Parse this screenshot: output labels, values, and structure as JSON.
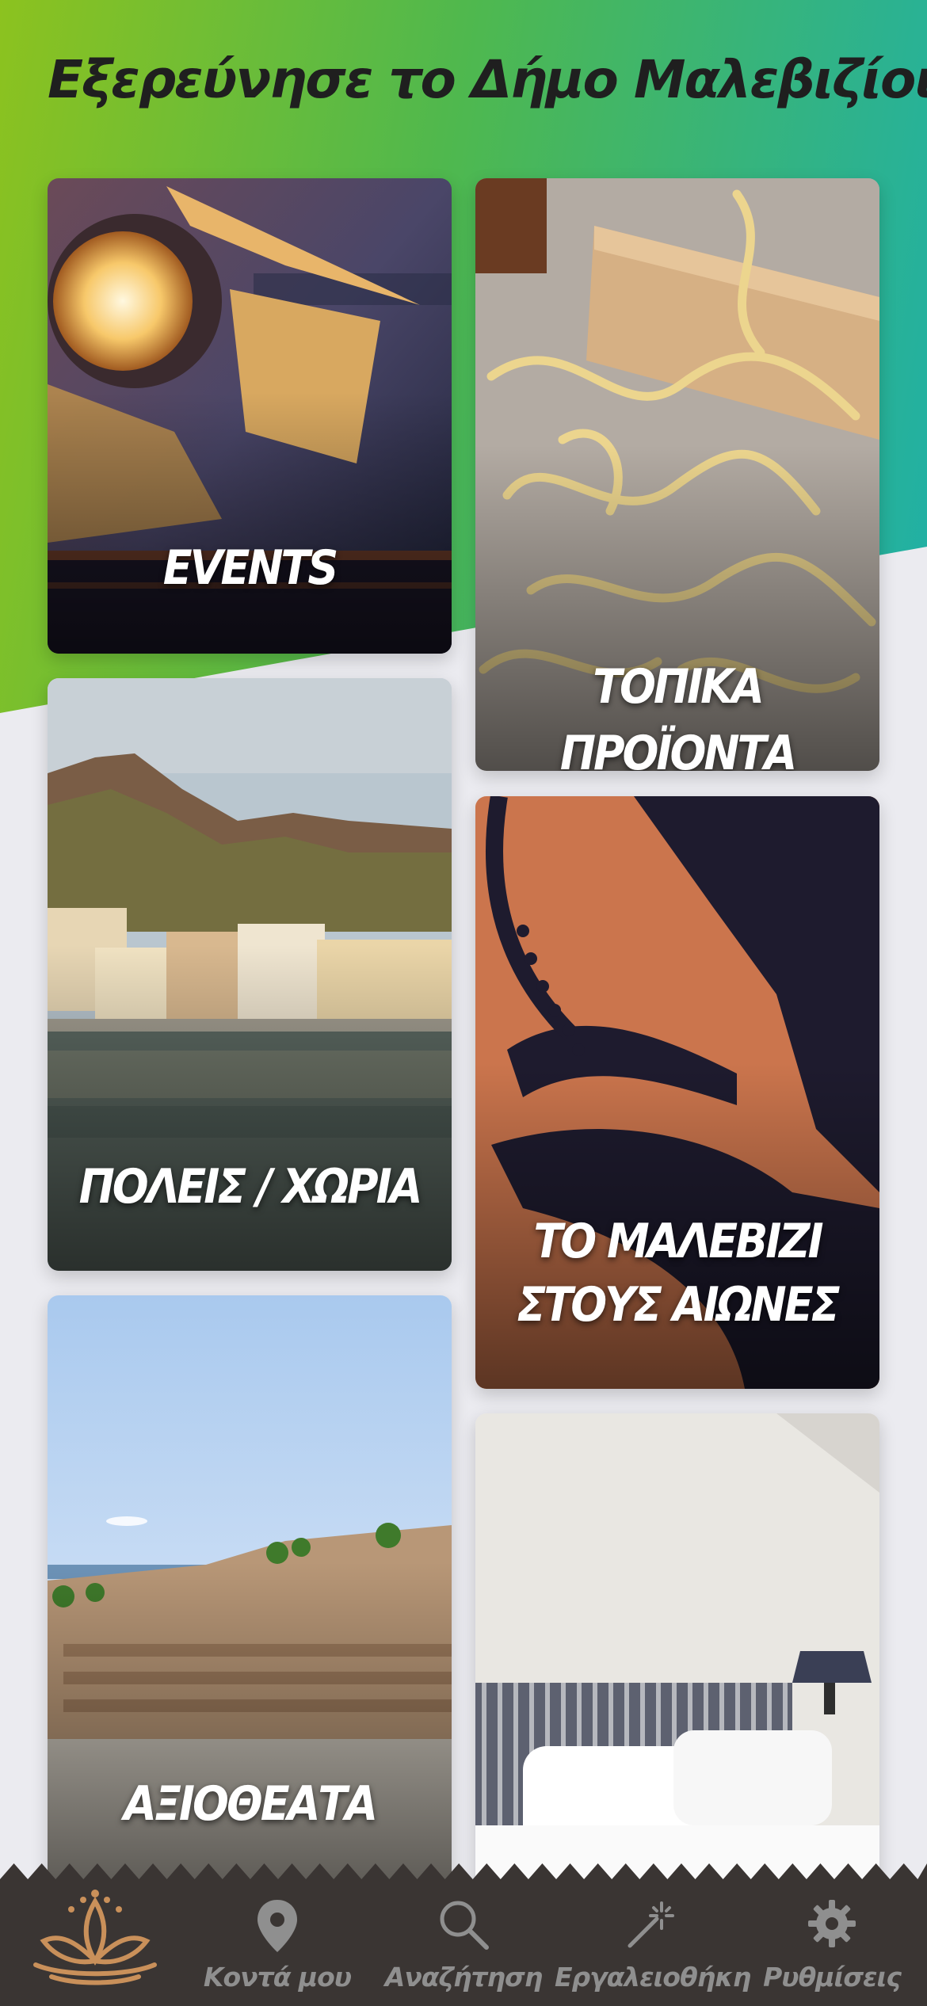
{
  "header": {
    "title": "Εξερεύνησε το Δήμο Μαλεβιζίου"
  },
  "cards": [
    {
      "label": "EVENTS"
    },
    {
      "label": "ΤΟΠΙΚΑ ΠΡΟΪΟΝΤΑ"
    },
    {
      "label": "ΠΟΛΕΙΣ / ΧΩΡΙΑ"
    },
    {
      "label_line1": "ΤΟ ΜΑΛΕΒΙΖΙ",
      "label_line2": "ΣΤΟΥΣ ΑΙΩΝΕΣ"
    },
    {
      "label": "ΑΞΙΟΘΕΑΤΑ"
    },
    {
      "label": ""
    }
  ],
  "nav": {
    "logo_icon": "malevizi-logo-icon",
    "items": [
      {
        "label": "Κοντά μου",
        "icon": "location-pin-icon"
      },
      {
        "label": "Αναζήτηση",
        "icon": "search-icon"
      },
      {
        "label": "Εργαλειοθήκη",
        "icon": "magic-wand-icon"
      },
      {
        "label": "Ρυθμίσεις",
        "icon": "gear-icon"
      }
    ]
  },
  "colors": {
    "gradient_start": "#8cc21f",
    "gradient_end": "#1fb0a8",
    "nav_bg": "#3a3533",
    "nav_text": "#8f8f8f"
  }
}
